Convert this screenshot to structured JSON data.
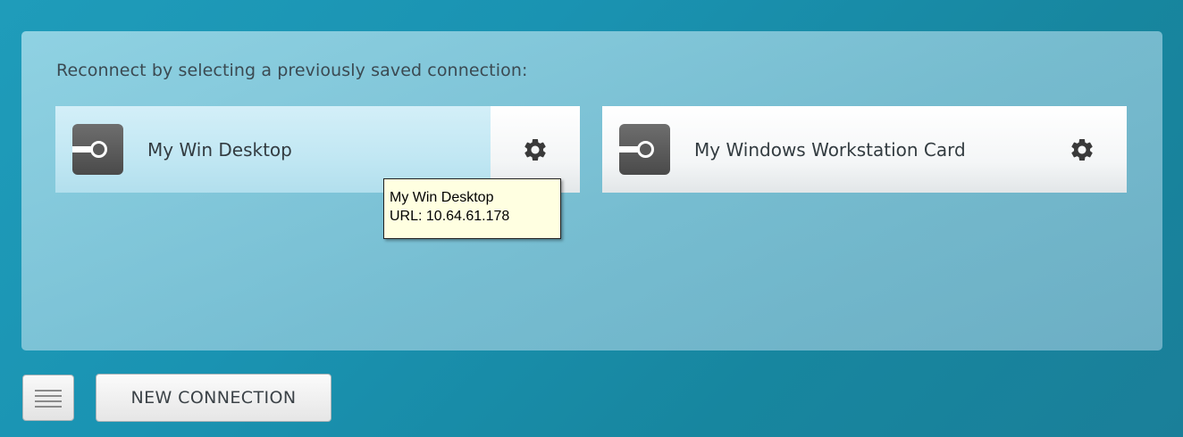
{
  "panel": {
    "heading": "Reconnect by selecting a previously saved connection:"
  },
  "connections": [
    {
      "label": "My Win Desktop",
      "state": "hovered",
      "icon": "remote-connection-icon",
      "settings_icon": "gear-icon"
    },
    {
      "label": "My Windows Workstation Card",
      "state": "normal",
      "icon": "remote-connection-icon",
      "settings_icon": "gear-icon"
    }
  ],
  "tooltip": {
    "title": "My Win Desktop",
    "url_line": "URL: 10.64.61.178"
  },
  "footer": {
    "menu_icon": "hamburger-menu-icon",
    "new_connection_label": "NEW CONNECTION"
  },
  "colors": {
    "background": "#1a93b2",
    "hover_card": "#c1e7f3",
    "tooltip_bg": "#ffffe1",
    "icon_dark": "#4a4a4a"
  }
}
